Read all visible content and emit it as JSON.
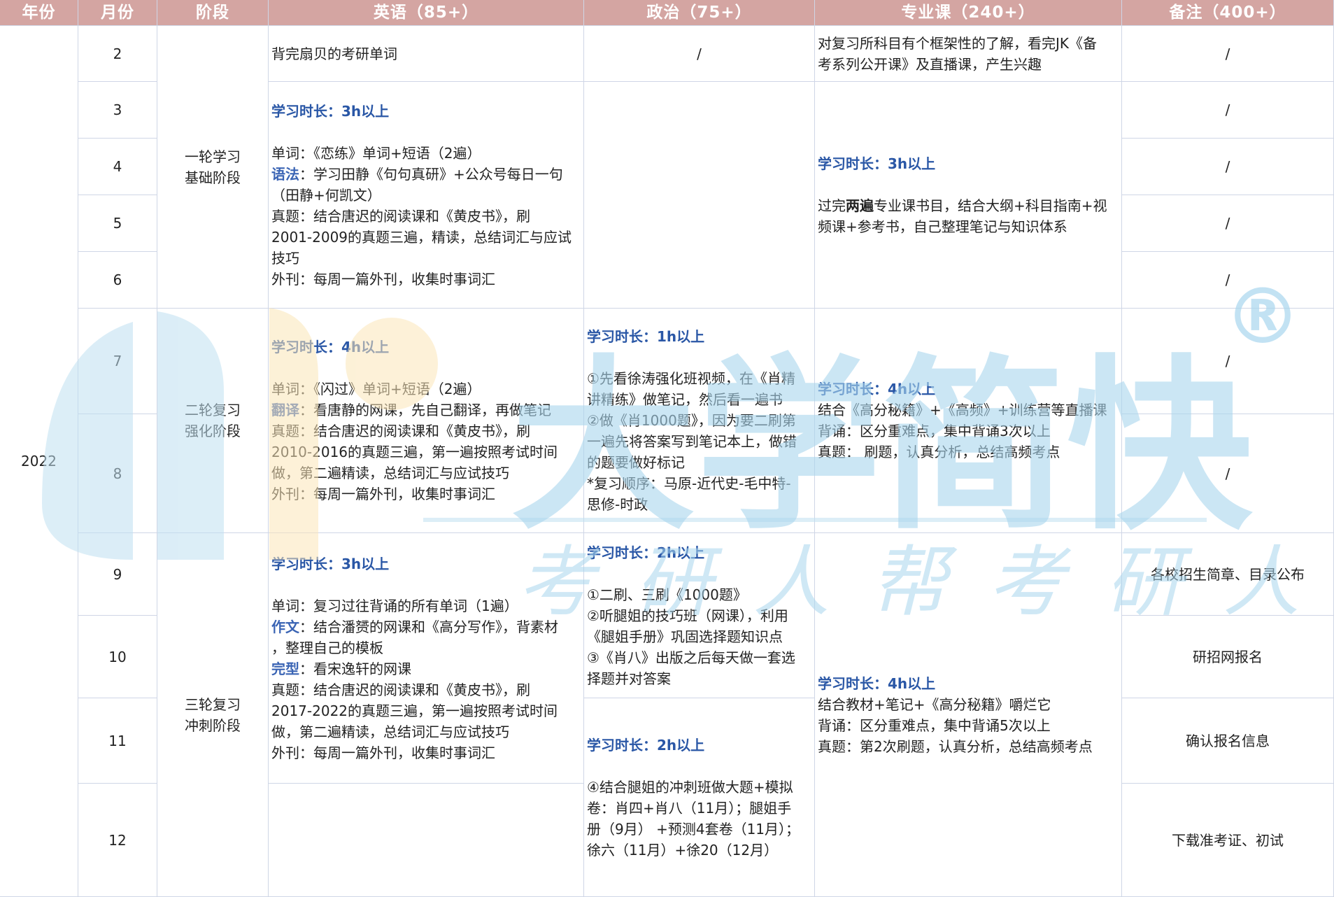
{
  "headers": {
    "year": "年份",
    "month": "月份",
    "stage": "阶段",
    "english": "英语（85+）",
    "politics": "政治（75+）",
    "major": "专业课（240+）",
    "notes": "备注（400+）"
  },
  "year": "2022",
  "months": [
    "2",
    "3",
    "4",
    "5",
    "6",
    "7",
    "8",
    "9",
    "10",
    "11",
    "12"
  ],
  "stages": {
    "s1": [
      "一轮学习",
      "基础阶段"
    ],
    "s2": [
      "二轮复习",
      "强化阶段"
    ],
    "s3": [
      "三轮复习",
      "冲刺阶段"
    ]
  },
  "english": {
    "feb": "背完扇贝的考研单词",
    "r1": {
      "duration": "学习时长：3h以上",
      "l1": "单词：《恋练》单词+短语（2遍）",
      "l2_key": "语法",
      "l2_rest": "：学习田静《句句真研》+公众号每日一句",
      "l3": "（田静+何凯文）",
      "l4": "真题：结合唐迟的阅读课和《黄皮书》，刷",
      "l5": "2001-2009的真题三遍，精读，总结词汇与应试",
      "l6": "技巧",
      "l7": "外刊：每周一篇外刊，收集时事词汇"
    },
    "r2": {
      "duration": "学习时长：4h以上",
      "l1": "单词：《闪过》单词+短语（2遍）",
      "l2_key": "翻译",
      "l2_rest": "：看唐静的网课，先自己翻译，再做笔记",
      "l3": "真题：结合唐迟的阅读课和《黄皮书》，刷",
      "l4": "2010-2016的真题三遍，第一遍按照考试时间",
      "l5": "做，第二遍精读，总结词汇与应试技巧",
      "l6": "外刊：每周一篇外刊，收集时事词汇"
    },
    "r3": {
      "duration": "学习时长：3h以上",
      "l1": "单词：复习过往背诵的所有单词（1遍）",
      "l2_key": "作文",
      "l2_rest": "：结合潘赟的网课和《高分写作》，背素材",
      "l3": "，整理自己的模板",
      "l4_key": "完型",
      "l4_rest": "：看宋逸轩的网课",
      "l5": "真题：结合唐迟的阅读课和《黄皮书》，刷",
      "l6": "2017-2022的真题三遍，第一遍按照考试时间",
      "l7": "做，第二遍精读，总结词汇与应试技巧",
      "l8": "外刊：每周一篇外刊，收集时事词汇"
    }
  },
  "politics": {
    "feb": "/",
    "p1": {
      "duration": "学习时长：1h以上",
      "l1": "①先看徐涛强化班视频，在《肖精",
      "l2": "讲精练》做笔记，然后看一遍书",
      "l3": "②做《肖1000题》，因为要二刷第",
      "l4": "一遍先将答案写到笔记本上，做错",
      "l5": "的题要做好标记",
      "l6": " *复习顺序：马原-近代史-毛中特-",
      "l7": "思修-时政"
    },
    "p2": {
      "duration": "学习时长：2h以上",
      "l1": "①二刷、三刷《1000题》",
      "l2": "②听腿姐的技巧班（网课），利用",
      "l3": "《腿姐手册》巩固选择题知识点",
      "l4": "③《肖八》出版之后每天做一套选",
      "l5": "择题并对答案"
    },
    "p3": {
      "duration": "学习时长：2h以上",
      "l1": "④结合腿姐的冲刺班做大题+模拟",
      "l2": "卷：肖四+肖八（11月）；腿姐手",
      "l3": "册（9月） +预测4套卷（11月）；",
      "l4": "徐六（11月）+徐20（12月）"
    }
  },
  "major": {
    "feb_l1": "对复习所科目有个框架性的了解，看完JK《备",
    "feb_l2": "考系列公开课》及直播课，产生兴趣",
    "m1": {
      "duration": "学习时长：3h以上",
      "l1_a": "过完",
      "l1_b": "两遍",
      "l1_c": "专业课书目，结合大纲+科目指南+视",
      "l2": "频课+参考书，自己整理笔记与知识体系"
    },
    "m2": {
      "duration": "学习时长：4h以上",
      "l1": "结合《高分秘籍》+《高频》+训练营等直播课",
      "l2": "背诵：区分重难点，集中背诵3次以上",
      "l3": "真题： 刷题，认真分析，总结高频考点"
    },
    "m3": {
      "duration": "学习时长：4h以上",
      "l1": "结合教材+笔记+《高分秘籍》嚼烂它",
      "l2": "背诵：区分重难点，集中背诵5次以上",
      "l3": "真题：第2次刷题，认真分析，总结高频考点"
    }
  },
  "notes": {
    "n2": "/",
    "n3": "/",
    "n4": "/",
    "n5": "/",
    "n6": "/",
    "n7": "/",
    "n8": "/",
    "n9": "各校招生简章、目录公布",
    "n10": "研招网报名",
    "n11": "确认报名信息",
    "n12": "下载准考证、初试"
  },
  "watermark": {
    "brand": "大学简快",
    "registered": "®",
    "slogan": "考研人帮考研人",
    "colors": {
      "blue": "#bfe0f1",
      "yellow": "#fbe6b8",
      "brand_blue": "#a9d6ee"
    }
  }
}
